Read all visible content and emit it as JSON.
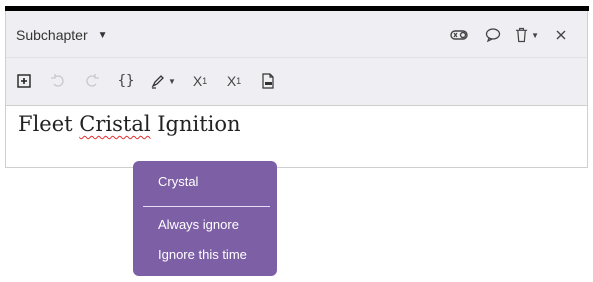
{
  "header": {
    "section_type": "Subchapter"
  },
  "header_icons": [
    "toggle-icon",
    "comment-icon",
    "trash-icon",
    "close-icon"
  ],
  "toolbar": {
    "code_label": "{}",
    "superscript_base": "X",
    "superscript_mark": "1",
    "subscript_base": "X",
    "subscript_mark": "1"
  },
  "editor": {
    "word1": "Fleet",
    "word2_misspelled": "Cristal",
    "word3": "Ignition"
  },
  "spell_menu": {
    "suggestion": "Crystal",
    "always_ignore": "Always ignore",
    "ignore_once": "Ignore this time"
  },
  "colors": {
    "menu_bg": "#7d5fa6",
    "toolbar_bg": "#efeff3",
    "spell_underline": "#e03030"
  }
}
